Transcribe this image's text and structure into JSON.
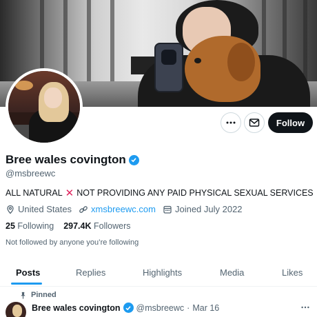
{
  "profile": {
    "display_name": "Bree wales covington",
    "handle": "@msbreewc",
    "bio_part1": "ALL NATURAL",
    "bio_part2": "NOT PROVIDING ANY PAID PHYSICAL SEXUAL SERVICES",
    "location": "United States",
    "website": "xmsbreewc.com",
    "joined": "Joined July 2022",
    "following_count": "25",
    "following_label": "Following",
    "followers_count": "297.4K",
    "followers_label": "Followers",
    "not_followed_text": "Not followed by anyone you’re following"
  },
  "actions": {
    "more_icon": "more-horizontal-icon",
    "message_icon": "envelope-icon",
    "follow_label": "Follow"
  },
  "tabs": [
    {
      "label": "Posts",
      "active": true
    },
    {
      "label": "Replies",
      "active": false
    },
    {
      "label": "Highlights",
      "active": false
    },
    {
      "label": "Media",
      "active": false
    },
    {
      "label": "Likes",
      "active": false
    }
  ],
  "pinned_post": {
    "pinned_label": "Pinned",
    "author_name": "Bree wales covington",
    "author_handle": "@msbreewc",
    "separator": "·",
    "date": "Mar 16"
  },
  "colors": {
    "accent": "#1d9bf0",
    "text": "#0f1419",
    "secondary": "#536471",
    "x_mark": "#e0245e"
  }
}
